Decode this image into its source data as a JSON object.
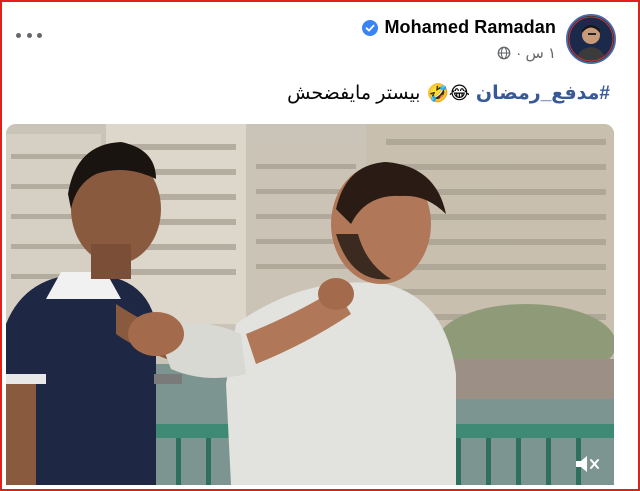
{
  "post": {
    "author": "Mohamed Ramadan",
    "time": "١ س ·",
    "caption": {
      "hashtag": "#مدفع_رمضان",
      "emojis": "😂🤣",
      "text": "بيستر مايفضحش"
    }
  },
  "icons": {
    "verified": "verified-badge-icon",
    "globe": "globe-icon",
    "more": "more-options-icon",
    "mute": "volume-muted-icon"
  },
  "colors": {
    "frame_border": "#e0201a",
    "verified": "#3b82f6",
    "hashtag": "#385898"
  }
}
